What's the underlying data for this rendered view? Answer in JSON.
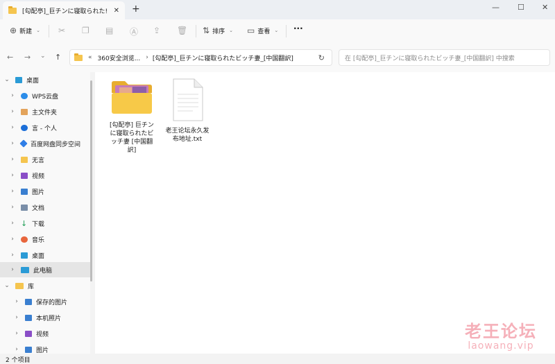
{
  "window": {
    "tab_title": "[勾配亭]_巨チンに寝取られた!",
    "tab_close": "✕",
    "new_tab": "+",
    "minimize": "—",
    "maximize": "☐",
    "close": "✕"
  },
  "toolbar": {
    "new_label": "新建",
    "sort_label": "排序",
    "view_label": "查看",
    "more_label": "···"
  },
  "navigation": {
    "back": "←",
    "forward": "→",
    "history": "⌄",
    "up": "↑",
    "address_overflow": "«",
    "address_parent": "360安全浏览...",
    "address_separator": "›",
    "address_current": "[勾配亭]_巨チンに寝取られたビッチ妻_[中国翻訳]",
    "refresh": "↻",
    "search_placeholder": "在 [勾配亭]_巨チンに寝取られたビッチ妻_[中国翻訳] 中搜索"
  },
  "sidebar": {
    "items": [
      {
        "label": "桌面",
        "chevron": "⌄",
        "color": "#2b9bd6"
      },
      {
        "label": "WPS云盘",
        "chevron": "›",
        "color": "#2c8de9"
      },
      {
        "label": "主文件夹",
        "chevron": "›",
        "color": "#e3a35b"
      },
      {
        "label": "言 - 个人",
        "chevron": "›",
        "color": "#1c6fd8"
      },
      {
        "label": "百度网盘同步空间",
        "chevron": "›",
        "color": "#2f7ee6"
      },
      {
        "label": "无言",
        "chevron": "›",
        "color": "#f5c54f"
      },
      {
        "label": "视频",
        "chevron": "›",
        "color": "#8a4ec7"
      },
      {
        "label": "图片",
        "chevron": "›",
        "color": "#3a7fd0"
      },
      {
        "label": "文档",
        "chevron": "›",
        "color": "#7a8ea8"
      },
      {
        "label": "下载",
        "chevron": "›",
        "color": "#1f9d55"
      },
      {
        "label": "音乐",
        "chevron": "›",
        "color": "#e8663d"
      },
      {
        "label": "桌面",
        "chevron": "›",
        "color": "#2b9bd6"
      },
      {
        "label": "此电脑",
        "chevron": "›",
        "color": "#2b9bd6"
      },
      {
        "label": "库",
        "chevron": "⌄",
        "color": "#f5c54f"
      },
      {
        "label": "保存的图片",
        "chevron": "›",
        "color": "#3a7fd0"
      },
      {
        "label": "本机照片",
        "chevron": "›",
        "color": "#3a7fd0"
      },
      {
        "label": "视频",
        "chevron": "›",
        "color": "#8a4ec7"
      },
      {
        "label": "图片",
        "chevron": "›",
        "color": "#3a7fd0"
      }
    ]
  },
  "files": [
    {
      "name": "[勾配亭] 巨チンに寝取られたビッチ妻 [中国翻訳]",
      "type": "folder"
    },
    {
      "name": "老王论坛永久发布地址.txt",
      "type": "text"
    }
  ],
  "status": {
    "count": "2 个项目"
  },
  "watermark": {
    "title": "老王论坛",
    "url": "laowang.vip"
  }
}
